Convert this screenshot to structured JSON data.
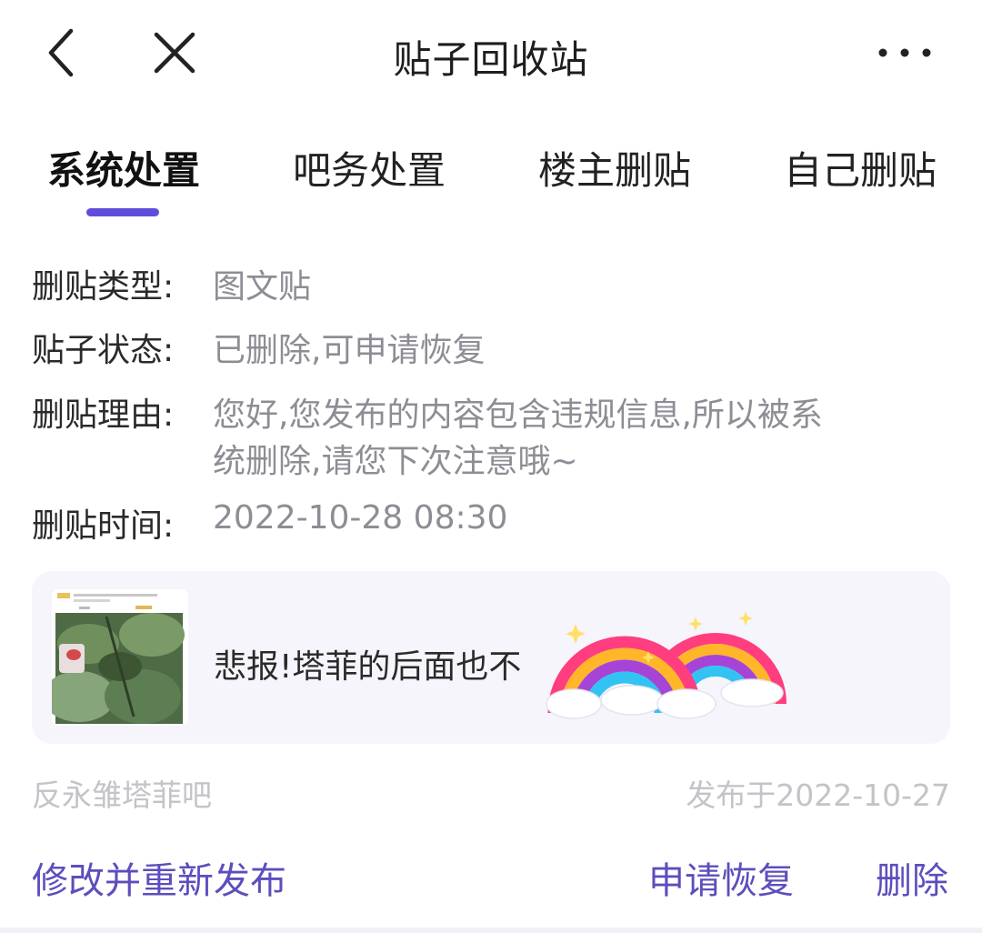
{
  "header": {
    "title": "贴子回收站",
    "back_icon": "chevron-left-icon",
    "close_icon": "close-icon",
    "more_icon": "more-horizontal-icon"
  },
  "tabs": [
    {
      "label": "系统处置",
      "active": true
    },
    {
      "label": "吧务处置",
      "active": false
    },
    {
      "label": "楼主删贴",
      "active": false
    },
    {
      "label": "自己删贴",
      "active": false
    }
  ],
  "accent_color": "#614ddc",
  "details": {
    "type_label": "删贴类型:",
    "type_value": "图文贴",
    "status_label": "贴子状态:",
    "status_value": "已删除,可申请恢复",
    "reason_label": "删贴理由:",
    "reason_line1": "您好,您发布的内容包含违规信息,所以被系",
    "reason_line2": "统删除,请您下次注意哦~",
    "time_label": "删贴时间:",
    "time_value": "2022-10-28 08:30"
  },
  "post": {
    "title": "悲报!塔菲的后面也不",
    "forum": "反永雏塔菲吧",
    "published": "发布于2022-10-27"
  },
  "actions": {
    "edit_republish": "修改并重新发布",
    "request_restore": "申请恢复",
    "delete": "删除"
  }
}
